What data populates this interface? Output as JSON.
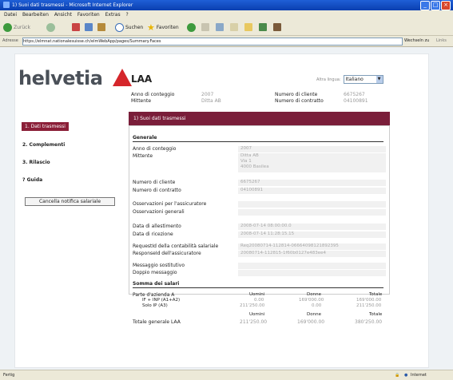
{
  "window": {
    "title": "1) Suoi dati trasmessi - Microsoft Internet Explorer"
  },
  "menu": [
    "Datei",
    "Bearbeiten",
    "Ansicht",
    "Favoriten",
    "Extras",
    "?"
  ],
  "toolbar": {
    "back": "Zurück",
    "search": "Suchen",
    "favorites": "Favoriten"
  },
  "address": {
    "label": "Adresse",
    "url": "https://elmnat.nationalesuisse.ch/elmWebApp/pages/Summary.Faces",
    "go_label": "Wechseln zu",
    "links_label": "Links"
  },
  "page": {
    "logo_text": "helvetia",
    "nav": [
      "1. Dati trasmessi",
      "2. Complementi",
      "3. Rilascio",
      "? Guida"
    ],
    "cancel_button": "Cancella notifica salariale",
    "title": "LAA",
    "language_label": "Altra lingua:",
    "language_value": "Italiano",
    "header_fields": {
      "anno_label": "Anno di conteggio",
      "anno_value": "2007",
      "mittente_label": "Mittente",
      "mittente_value": "Ditta AB",
      "cliente_label": "Numero di cliente",
      "cliente_value": "6675267",
      "contratto_label": "Numero di contratto",
      "contratto_value": "04100891"
    },
    "section_title": "1) Suoi dati trasmessi",
    "generale_heading": "Generale",
    "rows": {
      "anno": {
        "label": "Anno di conteggio",
        "value": "2007"
      },
      "mittente": {
        "label": "Mittente",
        "value1": "Ditta AB",
        "value2": "Via 1",
        "value3": "4000 Basilea"
      },
      "cliente": {
        "label": "Numero di cliente",
        "value": "6675267"
      },
      "contratto": {
        "label": "Numero di contratto",
        "value": "04100891"
      },
      "oss_assic": {
        "label": "Osservazioni per l'assicuratore",
        "value": ""
      },
      "oss_gen": {
        "label": "Osservazioni generali",
        "value": ""
      },
      "data_all": {
        "label": "Data di allestimento",
        "value": "2008-07-14 08:00:00.0"
      },
      "data_ric": {
        "label": "Data di ricezione",
        "value": "2008-07-14 11:28:15.15"
      },
      "request": {
        "label": "RequestId della contabilità salariale",
        "value": "Req20080714-112814-06664098121892395"
      },
      "response": {
        "label": "ResponseId dell'assicuratore",
        "value": "20080714-112815-1f60b0127e483ee4"
      },
      "messaggio": {
        "label": "Messaggio sostitutivo",
        "value": ""
      },
      "doppio": {
        "label": "Doppio messaggio",
        "value": ""
      }
    },
    "somma_heading": "Somma dei salari",
    "sums": {
      "parte_label": "Parte d'azienda A",
      "if_inp_label": "IF + INP (A1+A2)",
      "solo_label": "Solo IP (A3)",
      "col_uomini": "Uomini",
      "col_donne": "Donne",
      "col_totale": "Totale",
      "if_uomini": "0.00",
      "if_donne": "169'000.00",
      "if_totale": "169'000.00",
      "solo_uomini": "211'250.00",
      "solo_donne": "0.00",
      "solo_totale": "211'250.00",
      "totale_label": "Totale generale LAA",
      "tot_uomini": "211'250.00",
      "tot_donne": "169'000.00",
      "tot_totale": "380'250.00"
    }
  },
  "status": {
    "left": "Fertig",
    "zone": "Internet"
  }
}
